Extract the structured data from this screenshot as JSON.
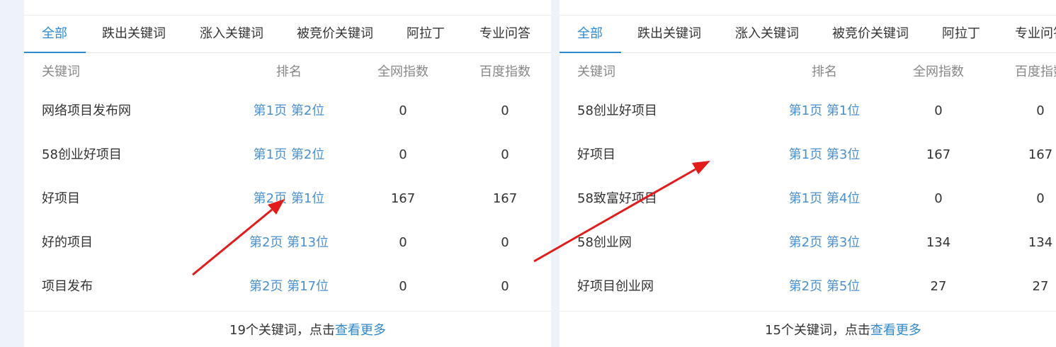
{
  "panels": [
    {
      "tabs": [
        "全部",
        "跌出关键词",
        "涨入关键词",
        "被竞价关键词",
        "阿拉丁",
        "专业问答"
      ],
      "columns": [
        "关键词",
        "排名",
        "全网指数",
        "百度指数"
      ],
      "rows": [
        {
          "keyword": "网络项目发布网",
          "rank": "第1页 第2位",
          "all_index": "0",
          "baidu_index": "0"
        },
        {
          "keyword": "58创业好项目",
          "rank": "第1页 第2位",
          "all_index": "0",
          "baidu_index": "0"
        },
        {
          "keyword": "好项目",
          "rank": "第2页 第1位",
          "all_index": "167",
          "baidu_index": "167"
        },
        {
          "keyword": "好的项目",
          "rank": "第2页 第13位",
          "all_index": "0",
          "baidu_index": "0"
        },
        {
          "keyword": "项目发布",
          "rank": "第2页 第17位",
          "all_index": "0",
          "baidu_index": "0"
        }
      ],
      "footer": {
        "prefix": "19个关键词，点击",
        "link": "查看更多"
      }
    },
    {
      "tabs": [
        "全部",
        "跌出关键词",
        "涨入关键词",
        "被竞价关键词",
        "阿拉丁",
        "专业问答"
      ],
      "columns": [
        "关键词",
        "排名",
        "全网指数",
        "百度指数"
      ],
      "rows": [
        {
          "keyword": "58创业好项目",
          "rank": "第1页 第1位",
          "all_index": "0",
          "baidu_index": "0"
        },
        {
          "keyword": "好项目",
          "rank": "第1页 第3位",
          "all_index": "167",
          "baidu_index": "167"
        },
        {
          "keyword": "58致富好项目",
          "rank": "第1页 第4位",
          "all_index": "0",
          "baidu_index": "0"
        },
        {
          "keyword": "58创业网",
          "rank": "第2页 第3位",
          "all_index": "134",
          "baidu_index": "134"
        },
        {
          "keyword": "好项目创业网",
          "rank": "第2页 第5位",
          "all_index": "27",
          "baidu_index": "27"
        }
      ],
      "footer": {
        "prefix": "15个关键词，点击",
        "link": "查看更多"
      }
    }
  ],
  "colors": {
    "accent": "#2f89d0",
    "rank_link": "#4a90d0",
    "annotation_arrow": "#e31b1b",
    "page_background": "#eef3f9"
  }
}
